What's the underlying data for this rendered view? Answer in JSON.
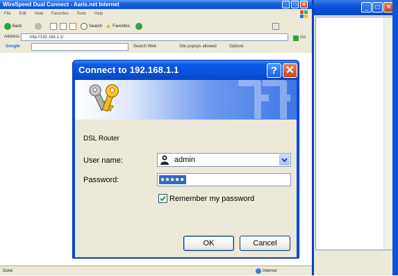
{
  "ie": {
    "title": "WireSpeed Dual Connect - Aaris.net Internet",
    "menu": [
      "File",
      "Edit",
      "View",
      "Favorites",
      "Tools",
      "Help"
    ],
    "toolbar": {
      "back_label": "Back",
      "search_label": "Search",
      "favorites_label": "Favorites"
    },
    "address": {
      "label": "Address",
      "value": "http://192.168.1.1/",
      "go_label": "Go"
    },
    "google": {
      "label": "Google",
      "search_web_label": "Search Web",
      "popups_label": "Site popups allowed",
      "options_label": "Options"
    },
    "status": {
      "left": "Done",
      "zone": "Internet"
    }
  },
  "dialog": {
    "title": "Connect to 192.168.1.1",
    "realm": "DSL Router",
    "username_label": "User name:",
    "username_value": "admin",
    "password_label": "Password:",
    "password_mask": "●●●●●",
    "remember_label": "Remember my password",
    "remember_checked": true,
    "ok_label": "OK",
    "cancel_label": "Cancel",
    "help_label": "?",
    "close_label": "✕"
  },
  "colors": {
    "xp_blue": "#0a54d8",
    "dialog_face": "#ece9d8",
    "selection": "#316ac5"
  }
}
